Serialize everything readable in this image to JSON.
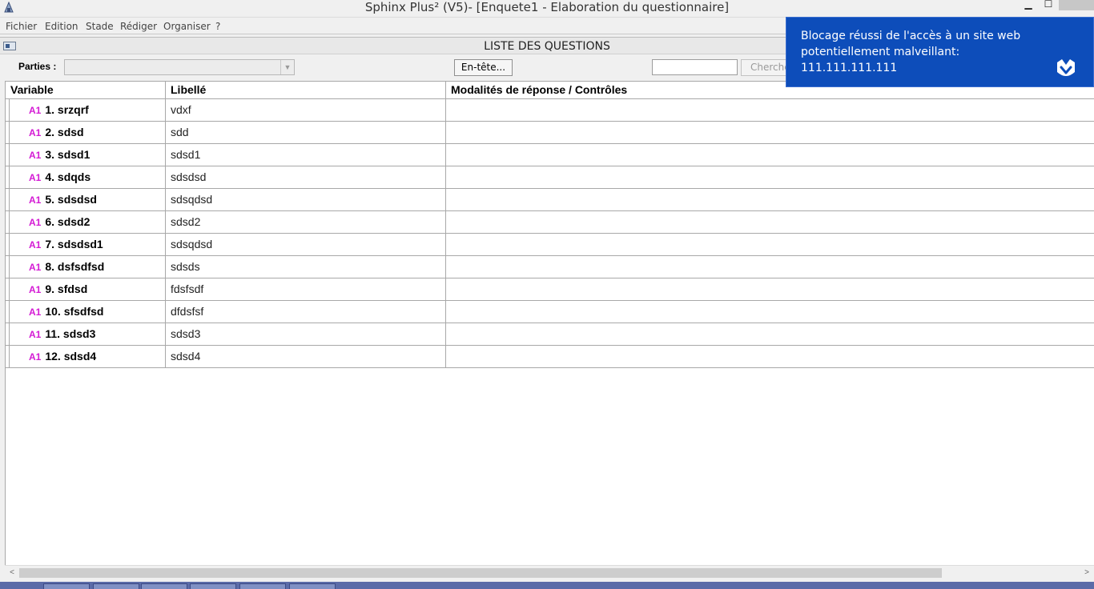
{
  "window": {
    "title": "Sphinx Plus² (V5)- [Enquete1 - Elaboration du questionnaire]",
    "minimize_glyph": "▁",
    "maximize_glyph": "☐"
  },
  "menu": [
    "Fichier",
    "Edition",
    "Stade",
    "Rédiger",
    "Organiser",
    "?"
  ],
  "inner_window": {
    "title": "LISTE DES QUESTIONS"
  },
  "toolbar": {
    "parties_label": "Parties :",
    "parties_value": "",
    "entete_label": "En-tête...",
    "search_value": "",
    "search_button_label": "Chercher"
  },
  "grid": {
    "headers": [
      "Variable",
      "Libellé",
      "Modalités de réponse / Contrôles"
    ],
    "rows": [
      {
        "tag": "A1",
        "variable": "1. srzqrf",
        "libelle": "vdxf",
        "modalites": ""
      },
      {
        "tag": "A1",
        "variable": "2. sdsd",
        "libelle": "sdd",
        "modalites": ""
      },
      {
        "tag": "A1",
        "variable": "3. sdsd1",
        "libelle": "sdsd1",
        "modalites": ""
      },
      {
        "tag": "A1",
        "variable": "4. sdqds",
        "libelle": "sdsdsd",
        "modalites": ""
      },
      {
        "tag": "A1",
        "variable": "5. sdsdsd",
        "libelle": "sdsqdsd",
        "modalites": ""
      },
      {
        "tag": "A1",
        "variable": "6. sdsd2",
        "libelle": "sdsd2",
        "modalites": ""
      },
      {
        "tag": "A1",
        "variable": "7. sdsdsd1",
        "libelle": "sdsqdsd",
        "modalites": ""
      },
      {
        "tag": "A1",
        "variable": "8. dsfsdfsd",
        "libelle": "sdsds",
        "modalites": ""
      },
      {
        "tag": "A1",
        "variable": "9. sfdsd",
        "libelle": "fdsfsdf",
        "modalites": ""
      },
      {
        "tag": "A1",
        "variable": "10. sfsdfsd",
        "libelle": "dfdsfsf",
        "modalites": ""
      },
      {
        "tag": "A1",
        "variable": "11. sdsd3",
        "libelle": "sdsd3",
        "modalites": ""
      },
      {
        "tag": "A1",
        "variable": "12. sdsd4",
        "libelle": "sdsd4",
        "modalites": ""
      }
    ]
  },
  "scrollbar": {
    "left_arrow": "<",
    "right_arrow": ">"
  },
  "notification": {
    "message": "Blocage réussi de l'accès à un site web potentiellement malveillant: 111.111.111.111",
    "icon": "malwarebytes-icon",
    "background": "#0d4dba"
  },
  "colors": {
    "tag": "#d41ad4",
    "toast_bg": "#0d4dba",
    "taskbar": "#5b6ba8"
  }
}
